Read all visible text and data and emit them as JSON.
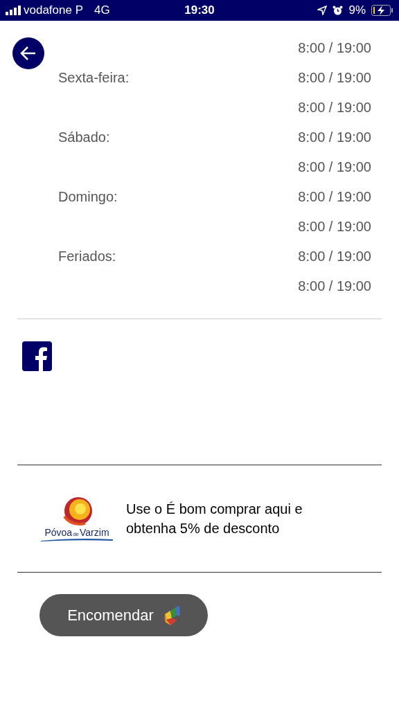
{
  "status_bar": {
    "carrier": "vodafone P",
    "network": "4G",
    "time": "19:30",
    "battery": "9%"
  },
  "schedule": [
    {
      "slots": [
        "8:00 / 19:00"
      ]
    },
    {
      "day": "Sexta-feira:",
      "slots": [
        "8:00 / 19:00",
        "8:00 / 19:00"
      ]
    },
    {
      "day": "Sábado:",
      "slots": [
        "8:00 / 19:00",
        "8:00 / 19:00"
      ]
    },
    {
      "day": "Domingo:",
      "slots": [
        "8:00 / 19:00",
        "8:00 / 19:00"
      ]
    },
    {
      "day": "Feriados:",
      "slots": [
        "8:00 / 19:00",
        "8:00 / 19:00"
      ]
    }
  ],
  "promo": {
    "logo": {
      "word_1": "Póvoa",
      "word_2": "de",
      "word_3": "Varzim"
    },
    "text": "Use o É bom comprar aqui e obtenha 5% de desconto"
  },
  "order_button": {
    "label": "Encomendar"
  }
}
